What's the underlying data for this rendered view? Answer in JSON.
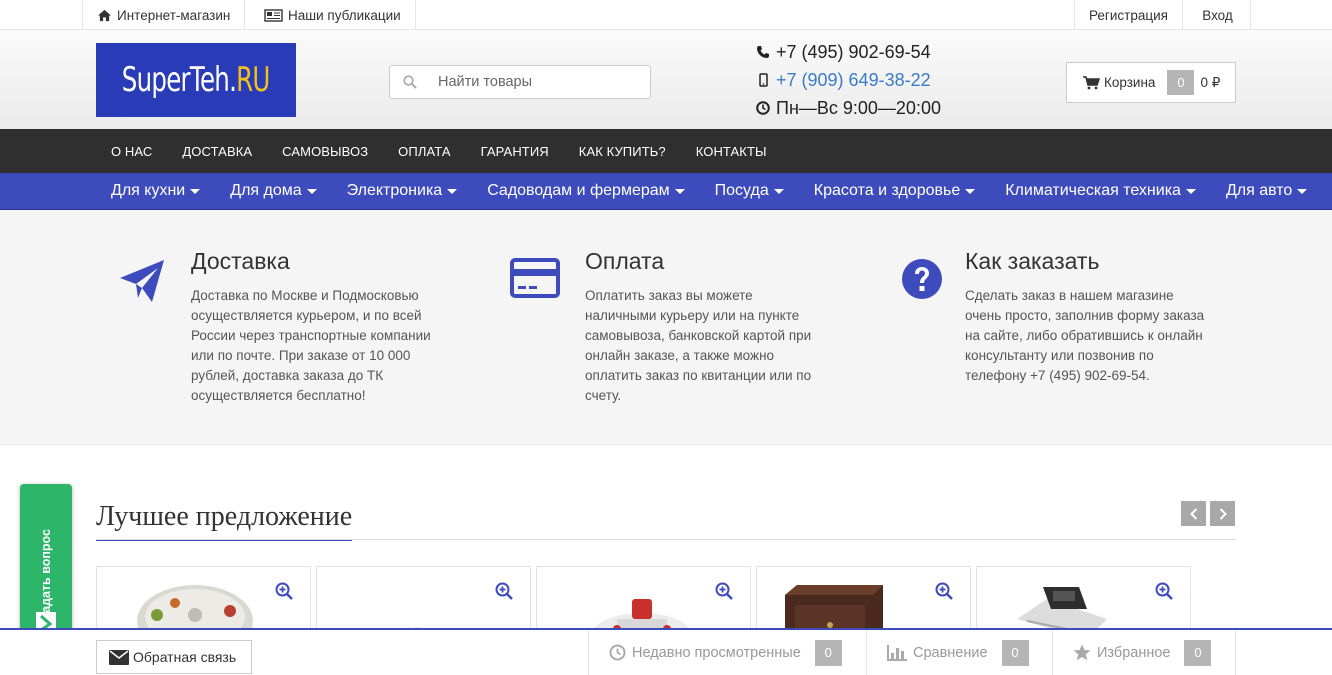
{
  "topbar": {
    "shop_label": "Интернет-магазин",
    "publications_label": "Наши публикации",
    "register_label": "Регистрация",
    "login_label": "Вход"
  },
  "header": {
    "logo_main": "SuperTeh.",
    "logo_suffix": "RU",
    "search_placeholder": "Найти товары",
    "phone": "+7 (495) 902-69-54",
    "mobile": "+7 (909) 649-38-22",
    "hours": "Пн—Вс 9:00—20:00",
    "cart_label": "Корзина",
    "cart_count": "0",
    "cart_sum": "0 ₽"
  },
  "dark_menu": [
    "О нас",
    "Доставка",
    "Самовывоз",
    "Оплата",
    "Гарантия",
    "Как купить?",
    "Контакты"
  ],
  "catalog_menu": [
    "Для кухни",
    "Для дома",
    "Электроника",
    "Садоводам и фермерам",
    "Посуда",
    "Красота и здоровье",
    "Климатическая техника",
    "Для авто"
  ],
  "info": {
    "delivery_title": "Доставка",
    "delivery_text": "Доставка по Москве и Подмосковью осуществляется курьером, и по всей России через транспортные компании или по почте. При заказе от 10 000 рублей, доставка заказа до ТК осуществляется бесплатно!",
    "payment_title": "Оплата",
    "payment_text": "Оплатить заказ вы можете наличными курьеру или на пункте самовывоза, банковской картой при онлайн заказе, а также можно оплатить заказ по квитанции или по счету.",
    "order_title": "Как заказать",
    "order_text": "Сделать заказ в нашем магазине очень просто, заполнив форму заказа на сайте, либо обратившись к онлайн консультанту или позвонив по телефону +7 (495) 902-69-54."
  },
  "best": {
    "title": "Лучшее предложение"
  },
  "ask_label": "задать вопрос",
  "bottom": {
    "feedback_label": "Обратная связь",
    "recent_label": "Недавно просмотренные",
    "recent_count": "0",
    "compare_label": "Сравнение",
    "compare_count": "0",
    "favorites_label": "Избранное",
    "favorites_count": "0"
  },
  "colors": {
    "brand_blue": "#3d4bbd",
    "logo_blue": "#2a3bb7",
    "dark_nav": "#2f2f2f",
    "ask_green": "#2db66a"
  }
}
